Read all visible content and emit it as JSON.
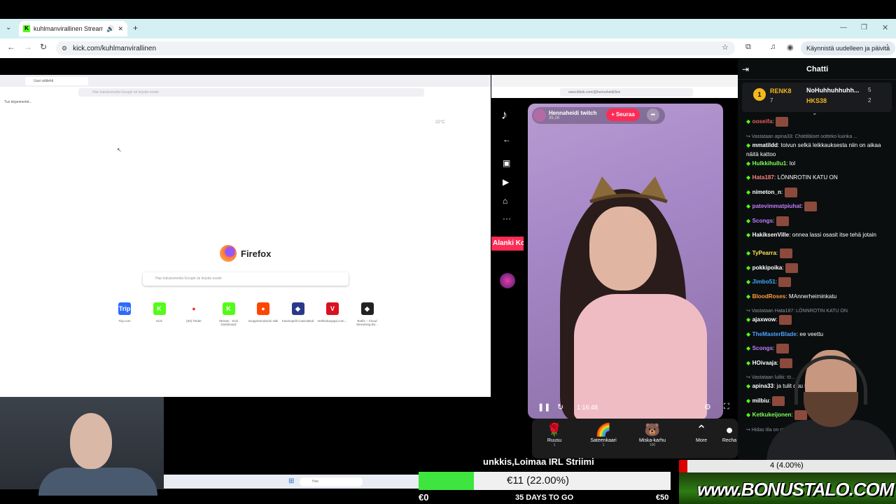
{
  "browser": {
    "tab_title": "kuhlmanvirallinen Stream",
    "url": "kick.com/kuhlmanvirallinen",
    "restart_button": "Käynnistä uudelleen ja päivitä"
  },
  "firefox": {
    "tab_title": "Uusi välilehti",
    "url_placeholder": "Hae hakukoneella Google tai kirjoita osoite",
    "bookmarks": "Tuo kirjanmerkit...",
    "weather": "22°C",
    "logo_text": "Firefox",
    "search_placeholder": "Hae hakukoneella Google tai kirjoita osoite",
    "shortcuts": [
      {
        "icon": "Trip",
        "label": "Trip.com",
        "color": "#2d6bff"
      },
      {
        "icon": "K",
        "label": "Kick",
        "color": "#53fc18"
      },
      {
        "icon": "●",
        "label": "(50) Tinder",
        "color": "#ffffff"
      },
      {
        "icon": "K",
        "label": "Stream · Kick Dashboard",
        "color": "#53fc18"
      },
      {
        "icon": "●",
        "label": "snuppresnoissini stile",
        "color": "#ff4500"
      },
      {
        "icon": "◆",
        "label": "Kasinopelit CasinoBud",
        "color": "#2a3a8a"
      },
      {
        "icon": "V",
        "label": "Verkkokauppa.com ...",
        "color": "#d8121f"
      },
      {
        "icon": "◆",
        "label": "Botfix – Cloud Streaming Bo...",
        "color": "#222222"
      }
    ],
    "taskbar_search": "Hae"
  },
  "tiktok": {
    "url": "www.tiktok.com/@hennaheidi/live",
    "promo": "Alanki Kolik",
    "host_name": "Hennaheidi twitch",
    "viewers": "35,1K",
    "follow": "+ Seuraa",
    "time": "1:16:48",
    "gifts": [
      {
        "name": "Ruusu",
        "price": "1",
        "icon": "🌹"
      },
      {
        "name": "Sateenkaari",
        "price": "1",
        "icon": "🌈"
      },
      {
        "name": "Miska-karhu",
        "price": "100",
        "icon": "🐻"
      },
      {
        "name": "More",
        "price": "",
        "icon": "⌃"
      },
      {
        "name": "Recha",
        "price": "",
        "icon": "●"
      }
    ]
  },
  "chat": {
    "title": "Chatti",
    "leaders": [
      {
        "rank": "1",
        "name": "RENK8",
        "count": "7"
      },
      {
        "rank": "",
        "name": "NoHuhhuhhuhh...",
        "count": "5"
      },
      {
        "rank": "",
        "name": "HKS38",
        "count": "2"
      }
    ],
    "messages": [
      {
        "user": "ooseifa",
        "color": "#e65d5d",
        "text": "",
        "emote": true,
        "reply": ""
      },
      {
        "user": "",
        "color": "#8e939c",
        "text": "",
        "emote": false,
        "reply": "↪ Vastataan apina33: Chättiläiset ootteko kuinka ..."
      },
      {
        "user": "mmatildd",
        "color": "#ffffff",
        "text": "toivun selkä leikkauksesta niin on aikaa näitä kattoo",
        "emote": false,
        "reply": ""
      },
      {
        "user": "Hulkkihullu1",
        "color": "#7dff5a",
        "text": "lol",
        "emote": false,
        "reply": ""
      },
      {
        "user": "Hata187",
        "color": "#ff7f7f",
        "text": "LÖNNROTIN KATU ON",
        "emote": false,
        "reply": ""
      },
      {
        "user": "nimeton_n",
        "color": "#ffffff",
        "text": "",
        "emote": true,
        "reply": ""
      },
      {
        "user": "patevimmatpiuhat",
        "color": "#c07dff",
        "text": "",
        "emote": true,
        "reply": ""
      },
      {
        "user": "Scongs",
        "color": "#c07dff",
        "text": "",
        "emote": true,
        "reply": ""
      },
      {
        "user": "HakiksenVille",
        "color": "#ffffff",
        "text": "onnea lassi osasit itse tehä jotain",
        "emote": false,
        "reply": ""
      },
      {
        "user": "TyPearra",
        "color": "#ffe24a",
        "text": "",
        "emote": true,
        "reply": ""
      },
      {
        "user": "pokkipoika",
        "color": "#ffffff",
        "text": "",
        "emote": true,
        "reply": ""
      },
      {
        "user": "Jimbo51",
        "color": "#3fa9ff",
        "text": "",
        "emote": true,
        "reply": ""
      },
      {
        "user": "BloodRoses",
        "color": "#ff9a3c",
        "text": "MAnnerheiminkatu",
        "emote": false,
        "reply": ""
      },
      {
        "user": "",
        "color": "#8e939c",
        "text": "",
        "emote": false,
        "reply": "↪ Vastataan Hata187: LÖNNROTIN KATU ON"
      },
      {
        "user": "ajaxwow",
        "color": "#ffffff",
        "text": "",
        "emote": true,
        "reply": ""
      },
      {
        "user": "TheMasterBlade",
        "color": "#4aa3ff",
        "text": "ee veettu",
        "emote": false,
        "reply": ""
      },
      {
        "user": "Scongs",
        "color": "#c07dff",
        "text": "",
        "emote": true,
        "reply": ""
      },
      {
        "user": "HOivaaja",
        "color": "#ffffff",
        "text": "",
        "emote": true,
        "reply": ""
      },
      {
        "user": "",
        "color": "#8e939c",
        "text": "",
        "emote": false,
        "reply": "↪ Vastataan luliki: tö..."
      },
      {
        "user": "apina33",
        "color": "#ffffff",
        "text": "ja tulit duu kuhlmanin striimiin",
        "emote": false,
        "reply": ""
      },
      {
        "user": "milbiu",
        "color": "#ffffff",
        "text": "",
        "emote": true,
        "reply": ""
      },
      {
        "user": "Ketkukeijonen",
        "color": "#7dff5a",
        "text": "",
        "emote": true,
        "reply": ""
      },
      {
        "user": "",
        "color": "#8e939c",
        "text": "",
        "emote": false,
        "reply": "↪ Hidas tila on ot..."
      }
    ]
  },
  "overlay": {
    "stream_title": "unkkis,Loimaa IRL Striimi",
    "top_goal": "4 (4.00%)",
    "goal_amount": "€11 (22.00%)",
    "goal_start": "€0",
    "goal_days": "35 DAYS TO GO",
    "goal_end": "€50",
    "goal_progress": 0.22,
    "sponsor": "www.BONUSTALO.COM"
  }
}
